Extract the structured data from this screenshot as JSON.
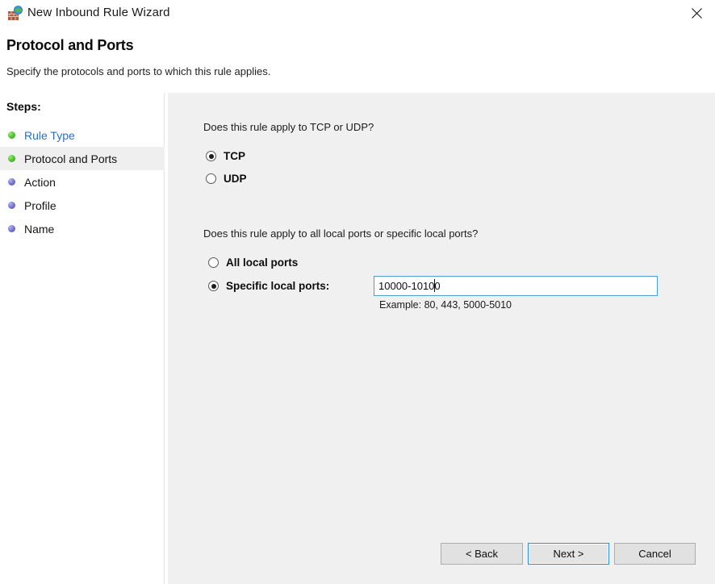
{
  "window": {
    "title": "New Inbound Rule Wizard",
    "icon": "firewall-globe-icon",
    "close_label": "✕"
  },
  "header": {
    "title": "Protocol and Ports",
    "subtitle": "Specify the protocols and ports to which this rule applies."
  },
  "sidebar": {
    "header": "Steps:",
    "items": [
      {
        "label": "Rule Type",
        "state": "done",
        "active": false,
        "link": true
      },
      {
        "label": "Protocol and Ports",
        "state": "done",
        "active": true,
        "link": false
      },
      {
        "label": "Action",
        "state": "pending",
        "active": false,
        "link": false
      },
      {
        "label": "Profile",
        "state": "pending",
        "active": false,
        "link": false
      },
      {
        "label": "Name",
        "state": "pending",
        "active": false,
        "link": false
      }
    ]
  },
  "main": {
    "protocol_question": "Does this rule apply to TCP or UDP?",
    "protocol_options": [
      {
        "label": "TCP",
        "selected": true
      },
      {
        "label": "UDP",
        "selected": false
      }
    ],
    "ports_question": "Does this rule apply to all local ports or specific local ports?",
    "ports_options": [
      {
        "label": "All local ports",
        "selected": false
      },
      {
        "label": "Specific local ports:",
        "selected": true
      }
    ],
    "ports_value": "10000-10100",
    "ports_placeholder": "",
    "ports_example": "Example: 80, 443, 5000-5010"
  },
  "footer": {
    "back_label": "< Back",
    "next_label": "Next >",
    "cancel_label": "Cancel"
  },
  "colors": {
    "link": "#2b6fc4",
    "focus_border": "#4c9ed9",
    "step_done": "#54c832",
    "step_pending": "#7a7ad6",
    "panel_bg": "#f0f0f0",
    "active_step_bg": "#efefef"
  }
}
